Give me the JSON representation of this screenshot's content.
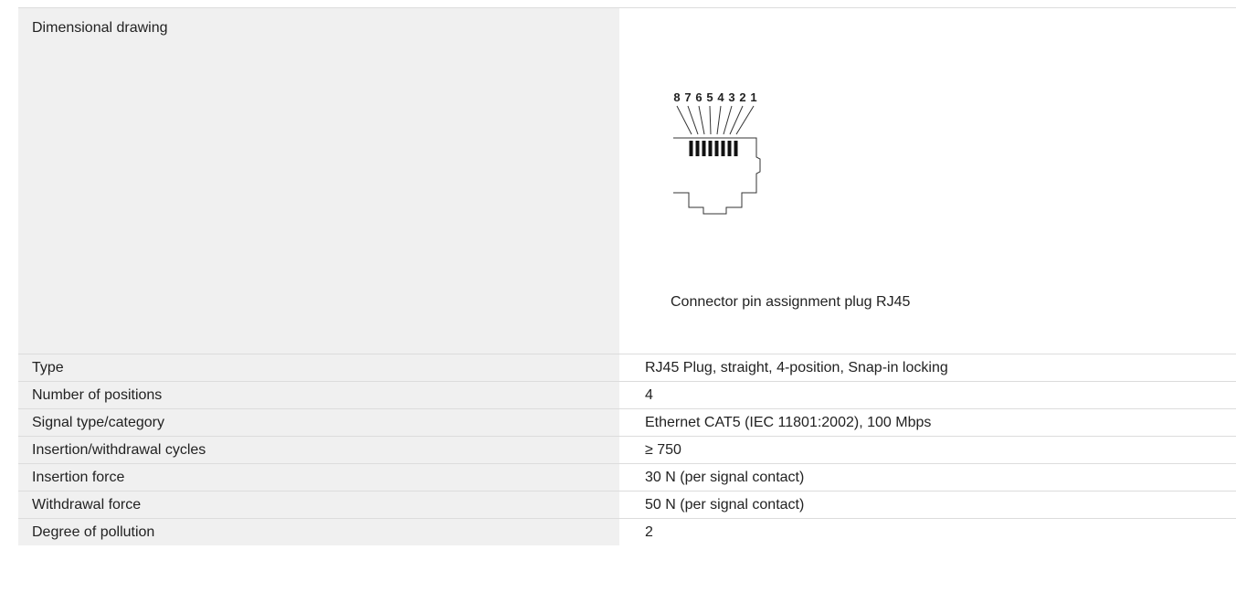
{
  "drawing": {
    "label": "Dimensional drawing",
    "pin_labels": [
      "8",
      "7",
      "6",
      "5",
      "4",
      "3",
      "2",
      "1"
    ],
    "caption": "Connector pin assignment plug RJ45"
  },
  "specs": [
    {
      "label": "Type",
      "value": "RJ45 Plug, straight, 4-position, Snap-in locking"
    },
    {
      "label": "Number of positions",
      "value": "4"
    },
    {
      "label": "Signal type/category",
      "value": "Ethernet CAT5 (IEC 11801:2002), 100 Mbps"
    },
    {
      "label": "Insertion/withdrawal cycles",
      "value": "≥ 750"
    },
    {
      "label": "Insertion force",
      "value": "30 N (per signal contact)"
    },
    {
      "label": "Withdrawal force",
      "value": "50 N (per signal contact)"
    },
    {
      "label": "Degree of pollution",
      "value": "2"
    }
  ]
}
